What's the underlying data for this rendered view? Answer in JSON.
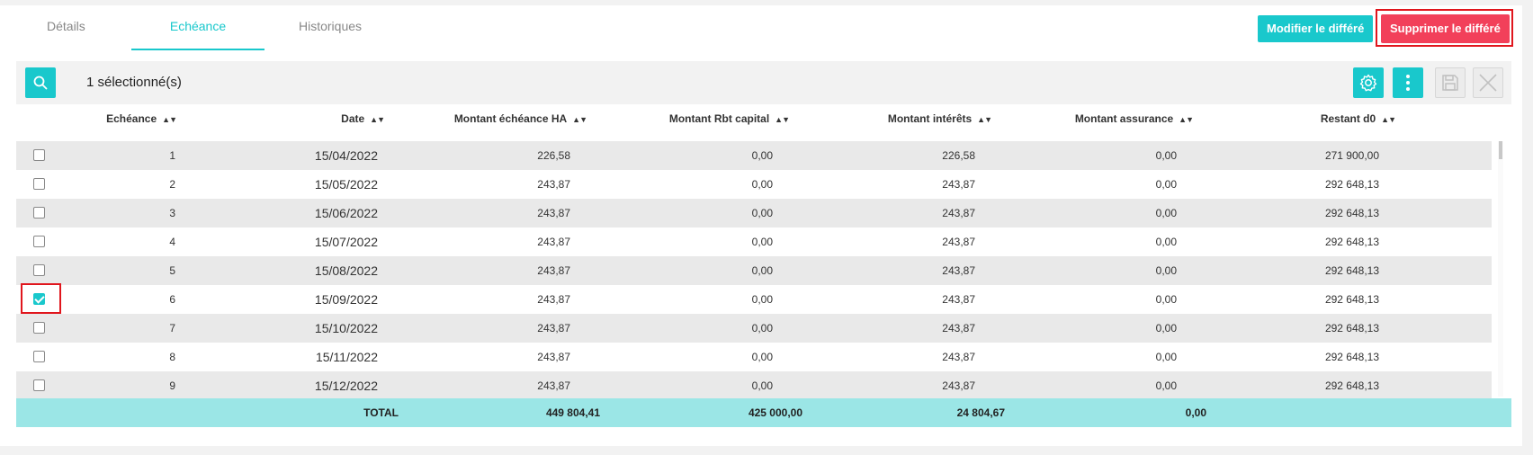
{
  "tabs": [
    {
      "label": "Détails",
      "active": false
    },
    {
      "label": "Echéance",
      "active": true
    },
    {
      "label": "Historiques",
      "active": false
    }
  ],
  "actions": {
    "modify_label": "Modifier le différé",
    "delete_label": "Supprimer le différé"
  },
  "toolbar": {
    "selection_text": "1 sélectionné(s)",
    "icons": [
      "search-icon",
      "gear-icon",
      "more-vertical-icon",
      "save-icon",
      "close-icon"
    ]
  },
  "table": {
    "columns": [
      "Echéance",
      "Date",
      "Montant échéance HA",
      "Montant Rbt capital",
      "Montant intérêts",
      "Montant assurance",
      "Restant d0"
    ],
    "rows": [
      {
        "num": "1",
        "date": "15/04/2022",
        "montant": "226,58",
        "capital": "0,00",
        "interets": "226,58",
        "assurance": "0,00",
        "restant": "271 900,00",
        "checked": false
      },
      {
        "num": "2",
        "date": "15/05/2022",
        "montant": "243,87",
        "capital": "0,00",
        "interets": "243,87",
        "assurance": "0,00",
        "restant": "292 648,13",
        "checked": false
      },
      {
        "num": "3",
        "date": "15/06/2022",
        "montant": "243,87",
        "capital": "0,00",
        "interets": "243,87",
        "assurance": "0,00",
        "restant": "292 648,13",
        "checked": false
      },
      {
        "num": "4",
        "date": "15/07/2022",
        "montant": "243,87",
        "capital": "0,00",
        "interets": "243,87",
        "assurance": "0,00",
        "restant": "292 648,13",
        "checked": false
      },
      {
        "num": "5",
        "date": "15/08/2022",
        "montant": "243,87",
        "capital": "0,00",
        "interets": "243,87",
        "assurance": "0,00",
        "restant": "292 648,13",
        "checked": false
      },
      {
        "num": "6",
        "date": "15/09/2022",
        "montant": "243,87",
        "capital": "0,00",
        "interets": "243,87",
        "assurance": "0,00",
        "restant": "292 648,13",
        "checked": true
      },
      {
        "num": "7",
        "date": "15/10/2022",
        "montant": "243,87",
        "capital": "0,00",
        "interets": "243,87",
        "assurance": "0,00",
        "restant": "292 648,13",
        "checked": false
      },
      {
        "num": "8",
        "date": "15/11/2022",
        "montant": "243,87",
        "capital": "0,00",
        "interets": "243,87",
        "assurance": "0,00",
        "restant": "292 648,13",
        "checked": false
      },
      {
        "num": "9",
        "date": "15/12/2022",
        "montant": "243,87",
        "capital": "0,00",
        "interets": "243,87",
        "assurance": "0,00",
        "restant": "292 648,13",
        "checked": false
      }
    ],
    "total": {
      "label": "TOTAL",
      "montant": "449 804,41",
      "capital": "425 000,00",
      "interets": "24 804,67",
      "assurance": "0,00"
    }
  },
  "colors": {
    "accent": "#19c8cc",
    "danger": "#f2405a",
    "total_row": "#9be6e6",
    "highlight_border": "#e0161d"
  }
}
